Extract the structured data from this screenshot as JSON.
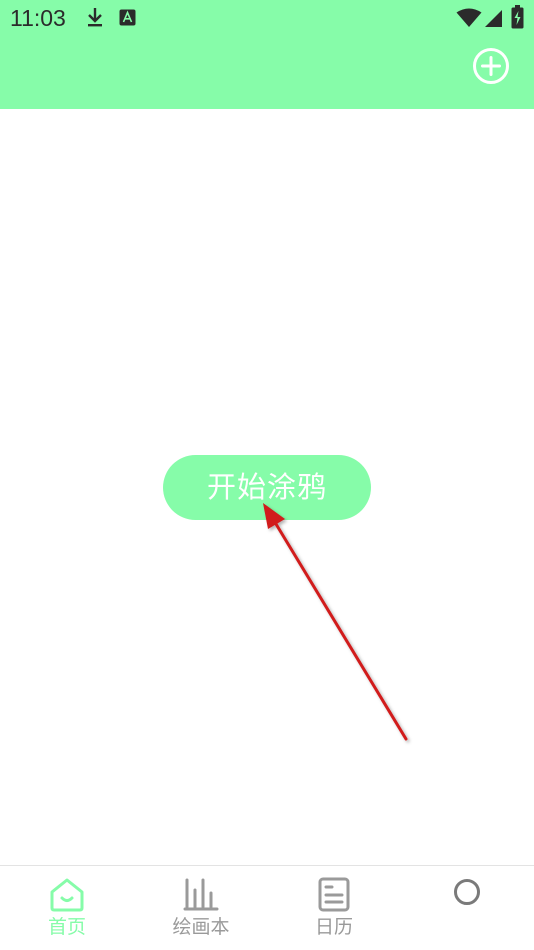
{
  "status_bar": {
    "time": "11:03",
    "icons": [
      "download-icon",
      "app-a-icon",
      "wifi-icon",
      "signal-icon",
      "battery-icon"
    ]
  },
  "header": {
    "add_icon": "plus-circle-icon"
  },
  "main": {
    "start_button_label": "开始涂鸦"
  },
  "tabbar": {
    "tabs": [
      {
        "label": "首页",
        "icon": "home-icon",
        "active": true
      },
      {
        "label": "绘画本",
        "icon": "bar-chart-icon",
        "active": false
      },
      {
        "label": "日历",
        "icon": "document-icon",
        "active": false
      },
      {
        "label": "",
        "icon": "circle-icon",
        "active": false
      }
    ]
  },
  "colors": {
    "accent": "#86fca9",
    "inactive": "#9a9a9a",
    "annotation": "#d11a1a"
  }
}
